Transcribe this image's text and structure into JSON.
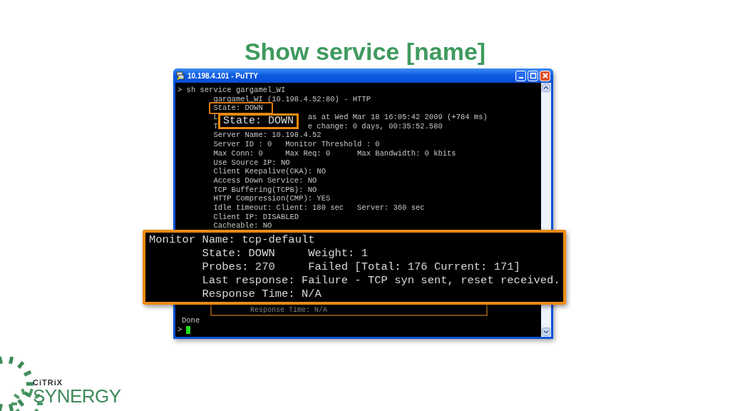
{
  "slide": {
    "title": "Show service [name]"
  },
  "window": {
    "title": "10.198.4.101 - PuTTY"
  },
  "terminal": {
    "lines": [
      {
        "kind": "prompt",
        "parts": [
          "> sh service gargamel_WI"
        ]
      },
      {
        "kind": "plain",
        "parts": [
          "gargamel_WI (10.198.4.52:80) - HTTP"
        ]
      },
      {
        "kind": "marked",
        "parts": [
          "State: DOWN"
        ]
      },
      {
        "kind": "covered",
        "parts": [
          "L",
          "as at Wed Mar 18 16:05:42 2009 (+784 ms)"
        ]
      },
      {
        "kind": "covered",
        "parts": [
          "T",
          "e change: 0 days, 00:35:52.580"
        ]
      },
      {
        "kind": "plain",
        "parts": [
          "Server Name: 10.198.4.52"
        ]
      },
      {
        "kind": "plain",
        "parts": [
          "Server ID : 0   Monitor Threshold : 0"
        ]
      },
      {
        "kind": "plain",
        "parts": [
          "Max Conn: 0     Max Req: 0      Max Bandwidth: 0 kbits"
        ]
      },
      {
        "kind": "plain",
        "parts": [
          "Use Source IP: NO"
        ]
      },
      {
        "kind": "plain",
        "parts": [
          "Client Keepalive(CKA): NO"
        ]
      },
      {
        "kind": "plain",
        "parts": [
          "Access Down Service: NO"
        ]
      },
      {
        "kind": "plain",
        "parts": [
          "TCP Buffering(TCPB): NO"
        ]
      },
      {
        "kind": "plain",
        "parts": [
          "HTTP Compression(CMP): YES"
        ]
      },
      {
        "kind": "plain",
        "parts": [
          "Idle timeout: Client: 180 sec   Server: 360 sec"
        ]
      },
      {
        "kind": "plain",
        "parts": [
          "Client IP: DISABLED"
        ]
      },
      {
        "kind": "plain",
        "parts": [
          "Cacheable: NO"
        ]
      }
    ],
    "covered_block": {
      "text": "Response Time: N/A"
    },
    "tail": [
      "Done",
      ">"
    ]
  },
  "state_callout": {
    "text": "State: DOWN"
  },
  "monitor_callout": {
    "lines": [
      "Monitor Name: tcp-default",
      "        State: DOWN     Weight: 1",
      "        Probes: 270     Failed [Total: 176 Current: 171]",
      "        Last response: Failure - TCP syn sent, reset received.",
      "        Response Time: N/A"
    ]
  },
  "logo": {
    "brand": "CiTRiX",
    "product": "SYNERGY"
  }
}
